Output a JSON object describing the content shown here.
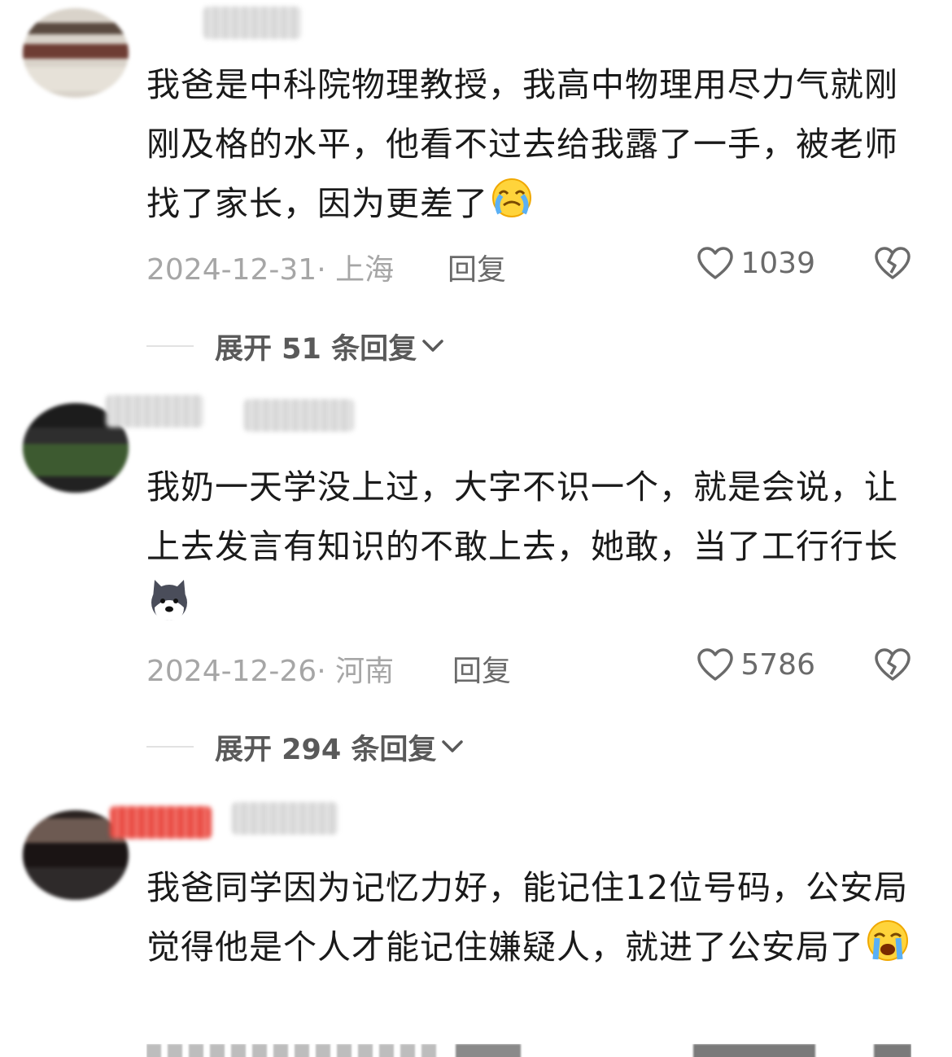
{
  "comments": [
    {
      "text": "我爸是中科院物理教授，我高中物理用尽力气就刚刚及格的水平，他看不过去给我露了一手，被老师找了家长，因为更差了",
      "emoji": "crying-face-emoji",
      "date": "2024-12-31· 上海",
      "reply_label": "回复",
      "likes": "1039",
      "expand_label": "展开 51 条回复"
    },
    {
      "text": "我奶一天学没上过，大字不识一个，就是会说，让上去发言有知识的不敢上去，她敢，当了工行行长",
      "emoji": "husky-dog-emoji",
      "date": "2024-12-26· 河南",
      "reply_label": "回复",
      "likes": "5786",
      "expand_label": "展开 294 条回复"
    },
    {
      "text": "我爸同学因为记忆力好，能记住12位号码，公安局觉得他是个人才能记住嫌疑人，就进了公安局了",
      "emoji": "loudly-crying-face-emoji"
    }
  ],
  "icons": {
    "like": "heart-outline-icon",
    "dislike": "broken-heart-icon",
    "expand": "chevron-down-icon"
  },
  "colors": {
    "meta_gray": "#a6a6a6",
    "text": "#1a1a1a"
  }
}
